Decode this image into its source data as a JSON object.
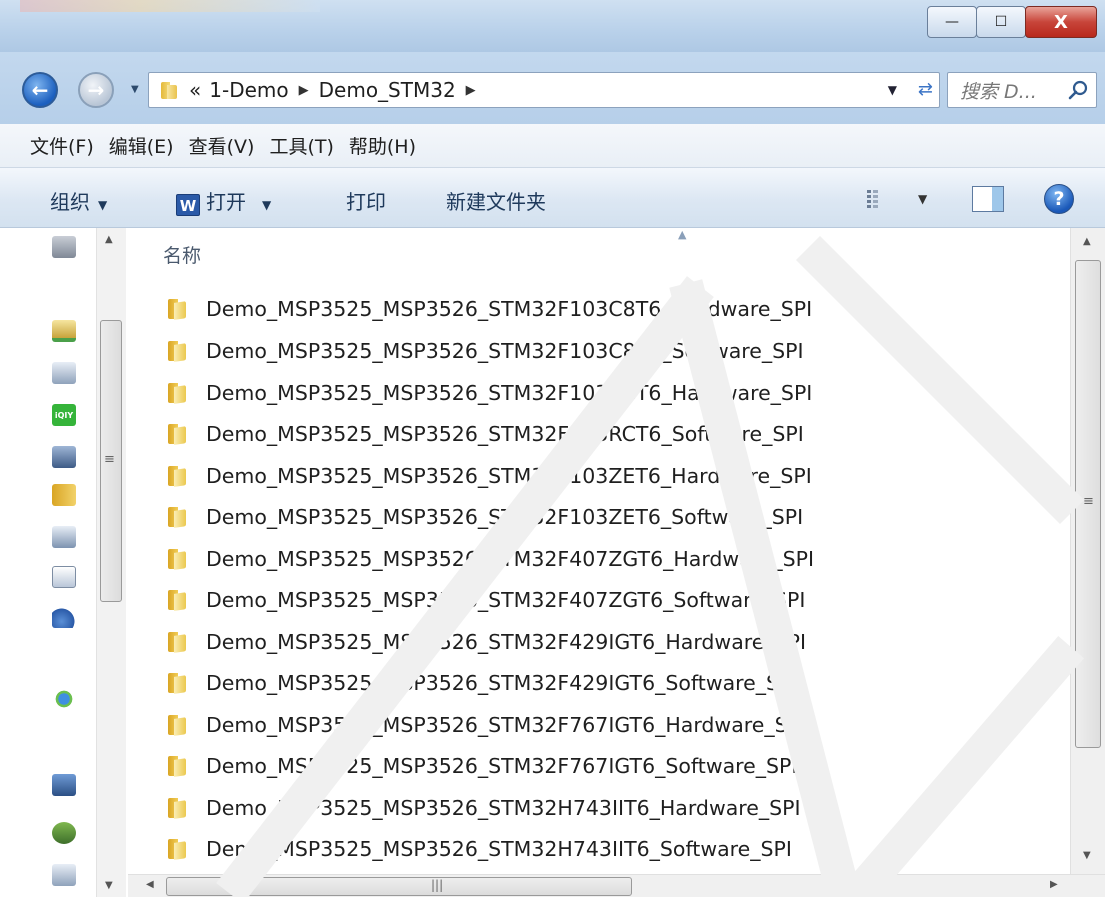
{
  "window": {
    "minimize_glyph": "—",
    "maximize_glyph": "☐",
    "close_glyph": "X"
  },
  "address_bar": {
    "overflow_glyph": "«",
    "crumbs": [
      "1-Demo",
      "Demo_STM32"
    ],
    "separator": "▶",
    "search_placeholder": "搜索 D..."
  },
  "menu": {
    "items": [
      "文件(F)",
      "编辑(E)",
      "查看(V)",
      "工具(T)",
      "帮助(H)"
    ]
  },
  "toolbar": {
    "organize": "组织",
    "open": "打开",
    "word_icon_letter": "W",
    "print": "打印",
    "new_folder": "新建文件夹",
    "help_glyph": "?"
  },
  "file_list": {
    "column_name": "名称",
    "items": [
      "Demo_MSP3525_MSP3526_STM32F103C8T6_Hardware_SPI",
      "Demo_MSP3525_MSP3526_STM32F103C8T6_Software_SPI",
      "Demo_MSP3525_MSP3526_STM32F103RCT6_Hardware_SPI",
      "Demo_MSP3525_MSP3526_STM32F103RCT6_Software_SPI",
      "Demo_MSP3525_MSP3526_STM32F103ZET6_Hardware_SPI",
      "Demo_MSP3525_MSP3526_STM32F103ZET6_Software_SPI",
      "Demo_MSP3525_MSP3526_STM32F407ZGT6_Hardware_SPI",
      "Demo_MSP3525_MSP3526_STM32F407ZGT6_Software_SPI",
      "Demo_MSP3525_MSP3526_STM32F429IGT6_Hardware_SPI",
      "Demo_MSP3525_MSP3526_STM32F429IGT6_Software_SPI",
      "Demo_MSP3525_MSP3526_STM32F767IGT6_Hardware_SPI",
      "Demo_MSP3525_MSP3526_STM32F767IGT6_Software_SPI",
      "Demo_MSP3525_MSP3526_STM32H743IIT6_Hardware_SPI",
      "Demo_MSP3525_MSP3526_STM32H743IIT6_Software_SPI"
    ]
  },
  "nav_pane": {
    "icons": [
      "computer-icon",
      "network-drive-icon",
      "drive-icon",
      "iqiyi-icon",
      "app-icon",
      "folder-icon",
      "drive-icon",
      "document-icon",
      "music-icon",
      "homegroup-icon",
      "computer-icon",
      "network-icon",
      "drive-icon"
    ],
    "iqiyi_label": "iQIY"
  },
  "colors": {
    "accent": "#1b5fbf",
    "folder": "#e9c24d",
    "titlebar": "#b9d1ea"
  }
}
